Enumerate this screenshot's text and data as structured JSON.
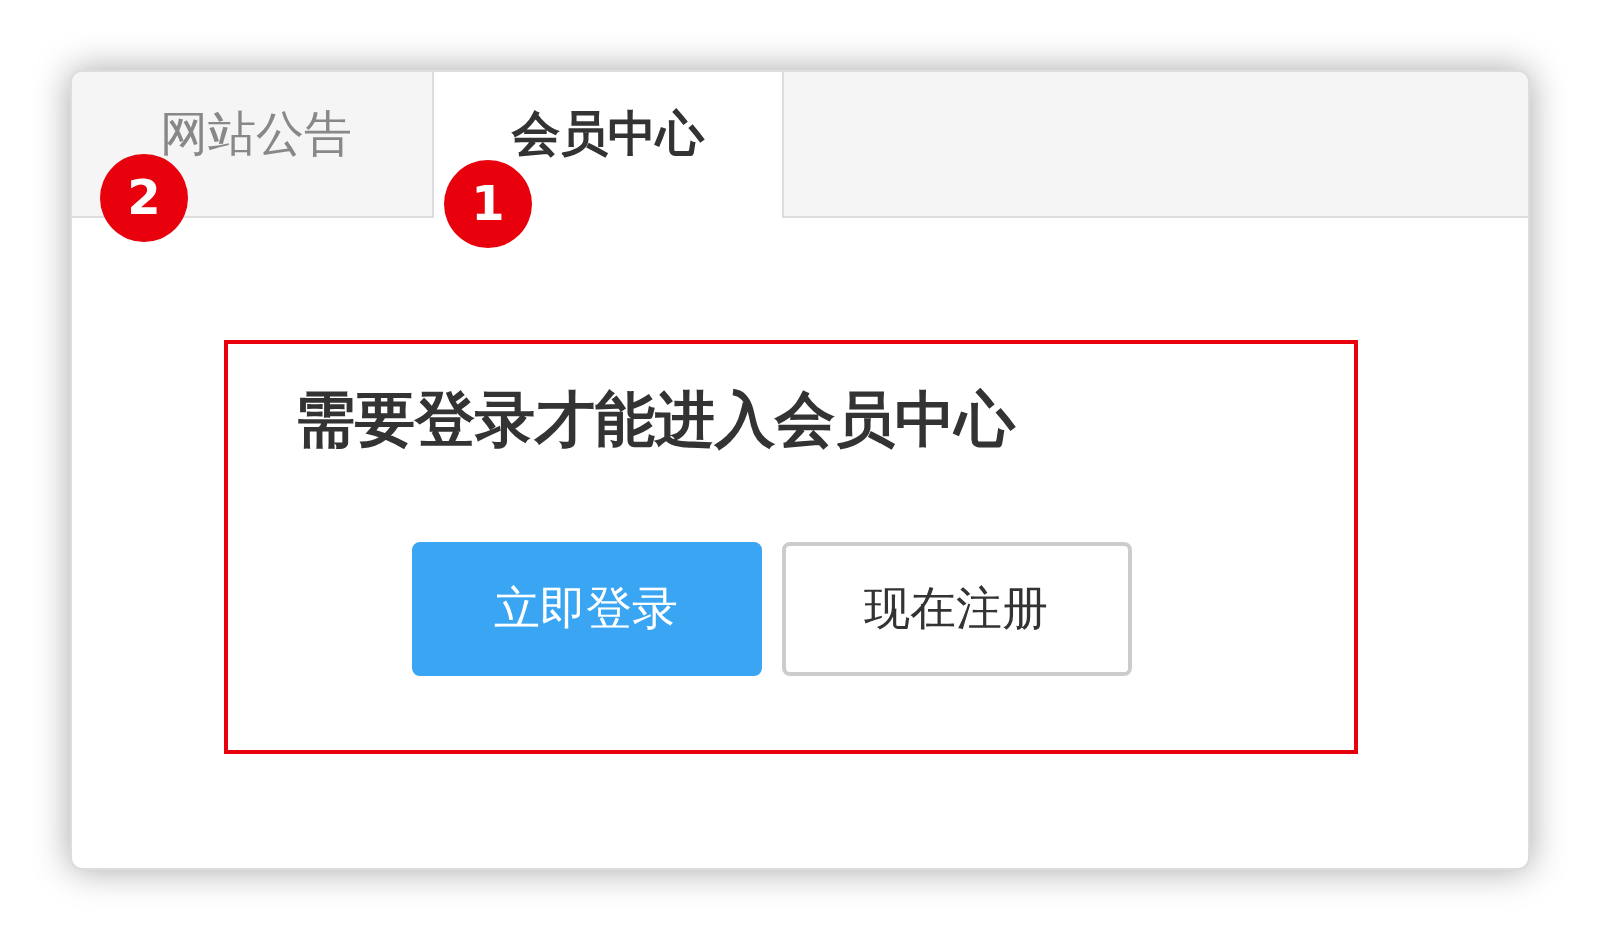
{
  "tabs": [
    {
      "label": "网站公告",
      "selected": false,
      "badge": "2"
    },
    {
      "label": "会员中心",
      "selected": true,
      "badge": "1"
    }
  ],
  "panel": {
    "message": "需要登录才能进入会员中心",
    "buttons": [
      {
        "label": "立即登录",
        "kind": "primary"
      },
      {
        "label": "现在注册",
        "kind": "default"
      }
    ]
  }
}
